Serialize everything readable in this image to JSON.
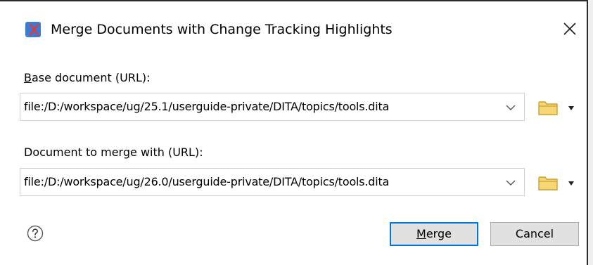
{
  "dialog": {
    "title": "Merge Documents with Change Tracking Highlights",
    "app_icon": "oxygen-x-icon",
    "close_icon": "close-icon"
  },
  "base": {
    "label_mnemonic": "B",
    "label_rest": "ase document (URL):",
    "value": "file:/D:/workspace/ug/25.1/userguide-private/DITA/topics/tools.dita"
  },
  "merge_with": {
    "label_pre": "Document to mer",
    "label_mnemonic": "g",
    "label_rest": "e with (URL):",
    "value": "file:/D:/workspace/ug/26.0/userguide-private/DITA/topics/tools.dita"
  },
  "buttons": {
    "merge_mnemonic": "M",
    "merge_rest": "erge",
    "cancel": "Cancel"
  },
  "colors": {
    "accent": "#0078d7",
    "folder": "#f2c94c",
    "app_icon_bg": "#3a7bd5",
    "app_icon_fg": "#e53935"
  }
}
